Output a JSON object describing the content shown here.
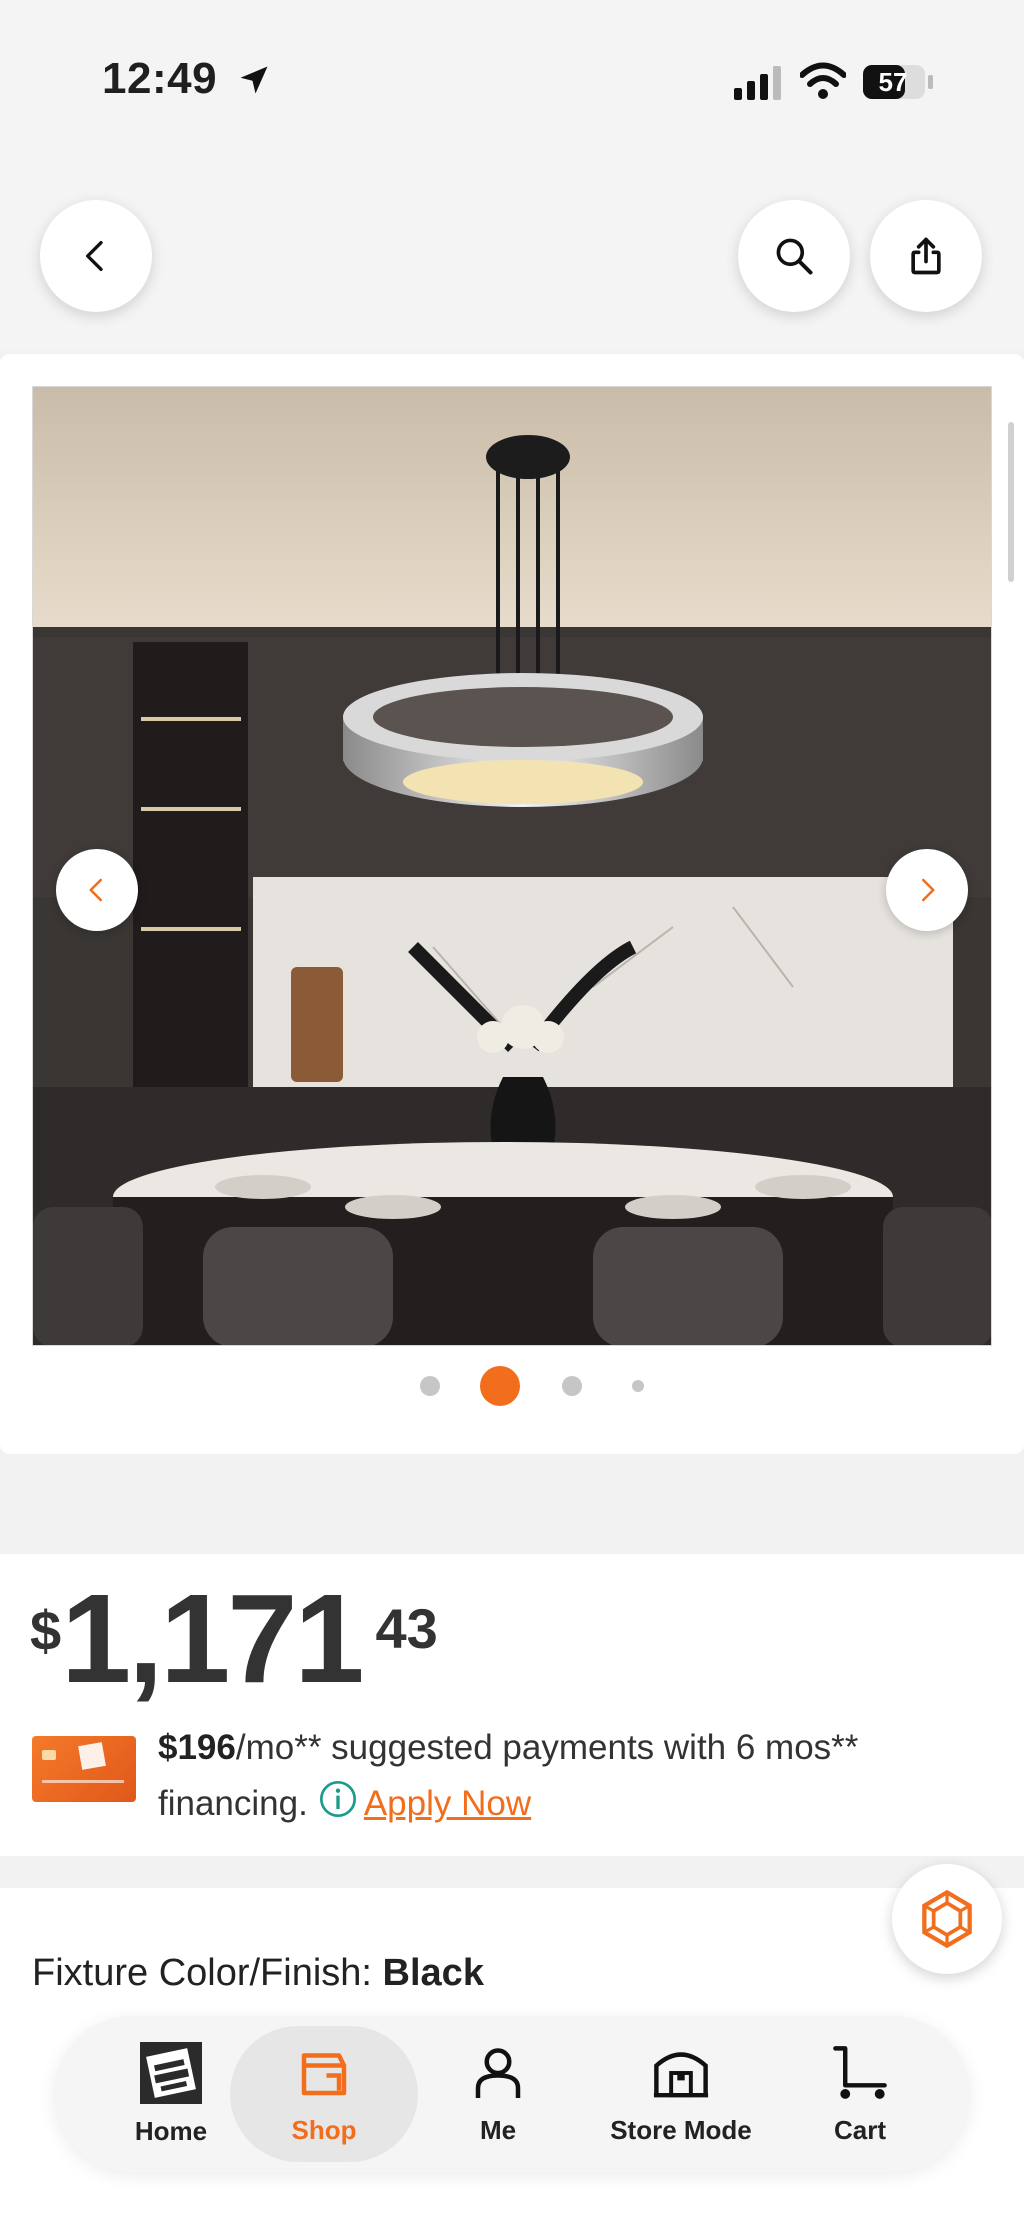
{
  "status": {
    "time": "12:49",
    "battery": "57"
  },
  "gallery": {
    "page_count": 4,
    "active_index": 1
  },
  "price": {
    "currency": "$",
    "dollars": "1,171",
    "cents": "43"
  },
  "financing": {
    "amount": "$196",
    "text_part1": "/mo** suggested payments with 6 mos**",
    "text_part2": "financing.",
    "apply_label": "Apply Now"
  },
  "variant": {
    "label": "Fixture Color/Finish:",
    "value": "Black"
  },
  "nav": [
    {
      "label": "Home",
      "icon": "home-depot-logo-icon"
    },
    {
      "label": "Shop",
      "icon": "shop-icon"
    },
    {
      "label": "Me",
      "icon": "person-icon"
    },
    {
      "label": "Store Mode",
      "icon": "store-icon"
    },
    {
      "label": "Cart",
      "icon": "cart-icon"
    }
  ],
  "colors": {
    "accent": "#f26d1c",
    "text": "#1f1f1f"
  }
}
